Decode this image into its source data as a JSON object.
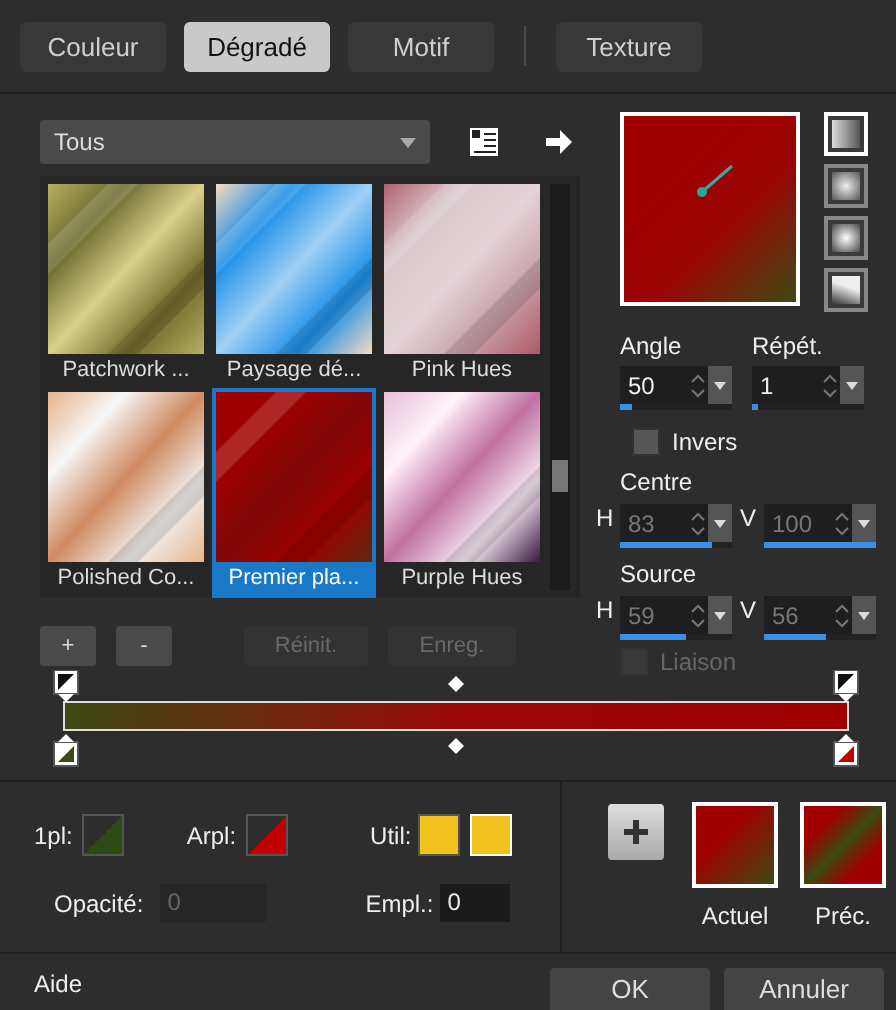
{
  "tabs": [
    {
      "label": "Couleur",
      "selected": false
    },
    {
      "label": "Dégradé",
      "selected": true
    },
    {
      "label": "Motif",
      "selected": false
    },
    {
      "label": "Texture",
      "selected": false
    }
  ],
  "category": {
    "value": "Tous"
  },
  "gradients": [
    {
      "name": "Patchwork ...",
      "selected": false
    },
    {
      "name": "Paysage dé...",
      "selected": false
    },
    {
      "name": "Pink Hues",
      "selected": false
    },
    {
      "name": "Polished Co...",
      "selected": false
    },
    {
      "name": "Premier pla...",
      "selected": true
    },
    {
      "name": "Purple Hues",
      "selected": false
    }
  ],
  "list_buttons": [
    {
      "label": "+",
      "disabled": false
    },
    {
      "label": "-",
      "disabled": false
    },
    {
      "label": "Réinit.",
      "disabled": true
    },
    {
      "label": "Enreg.",
      "disabled": true
    }
  ],
  "styles": [
    {
      "selected": true
    },
    {
      "selected": false
    },
    {
      "selected": false
    },
    {
      "selected": false
    }
  ],
  "angle": {
    "label": "Angle",
    "value": "50",
    "level": 0.1
  },
  "repeat": {
    "label": "Répét.",
    "value": "1",
    "level": 0.05
  },
  "invert": {
    "label": "Invers",
    "checked": false
  },
  "centre": {
    "label": "Centre",
    "disabled": true,
    "fields": [
      {
        "axis": "H",
        "value": "83",
        "level": 0.83
      },
      {
        "axis": "V",
        "value": "100",
        "level": 1
      }
    ]
  },
  "source": {
    "label": "Source",
    "disabled": true,
    "fields": [
      {
        "axis": "H",
        "value": "59",
        "level": 0.59
      },
      {
        "axis": "V",
        "value": "56",
        "level": 0.56
      }
    ]
  },
  "link": {
    "label": "Liaison",
    "checked": false,
    "disabled": true
  },
  "swatches": {
    "fg_label": "1pl:",
    "bg_label": "Arpl:",
    "user_label": "Util:"
  },
  "opacity": {
    "label": "Opacité:",
    "value": "0"
  },
  "location": {
    "label": "Empl.:",
    "value": "0"
  },
  "current_label": "Actuel",
  "previous_label": "Préc.",
  "footer": {
    "help": "Aide",
    "ok": "OK",
    "cancel": "Annuler"
  }
}
